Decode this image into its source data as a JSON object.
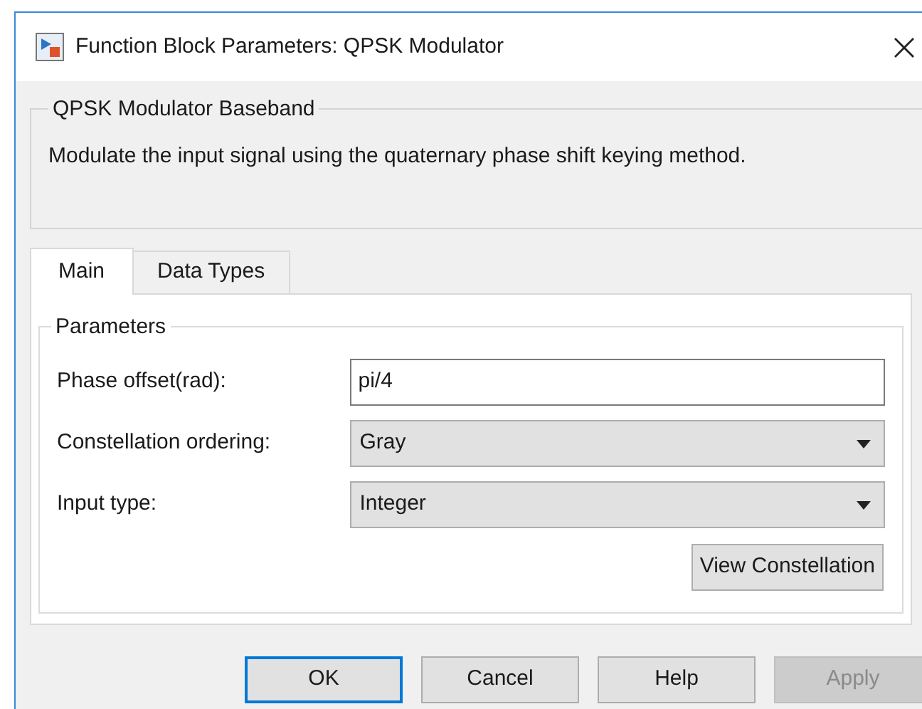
{
  "window": {
    "title": "Function Block Parameters: QPSK Modulator"
  },
  "block": {
    "title": "QPSK Modulator Baseband",
    "description": "Modulate the input signal using the quaternary phase shift keying method."
  },
  "tabs": [
    {
      "label": "Main",
      "selected": true
    },
    {
      "label": "Data Types",
      "selected": false
    }
  ],
  "parameters": {
    "title": "Parameters",
    "rows": [
      {
        "kind": "field",
        "label": "Phase offset(rad):",
        "value": "pi/4"
      },
      {
        "kind": "dropdown",
        "label": "Constellation ordering:",
        "value": "Gray"
      },
      {
        "kind": "dropdown",
        "label": "Input type:",
        "value": "Integer"
      }
    ],
    "action": "View Constellation"
  },
  "buttons": [
    {
      "label": "OK",
      "focused": true,
      "disabled": false
    },
    {
      "label": "Cancel",
      "focused": false,
      "disabled": false
    },
    {
      "label": "Help",
      "focused": false,
      "disabled": false
    },
    {
      "label": "Apply",
      "focused": false,
      "disabled": true
    }
  ]
}
